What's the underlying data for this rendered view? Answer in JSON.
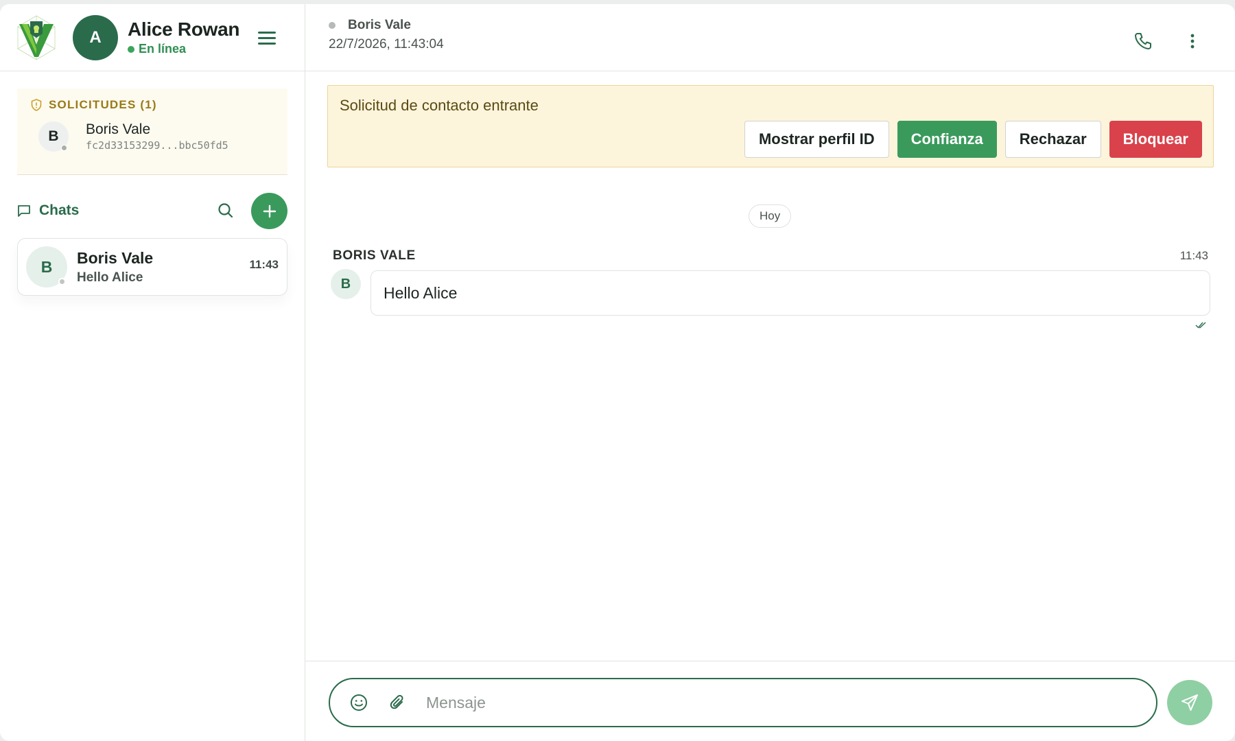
{
  "colors": {
    "brand": "#2a6b4b",
    "accent_green": "#3a9a5c",
    "danger": "#d9424b",
    "warning_bg": "#fdf4dc",
    "online": "#3aa55d"
  },
  "user": {
    "avatar_letter": "A",
    "name": "Alice Rowan",
    "status": "En línea"
  },
  "requests": {
    "title": "SOLICITUDES (1)",
    "items": [
      {
        "avatar_letter": "B",
        "name": "Boris Vale",
        "id": "fc2d33153299...bbc50fd5"
      }
    ]
  },
  "chats": {
    "title": "Chats",
    "items": [
      {
        "avatar_letter": "B",
        "name": "Boris Vale",
        "preview": "Hello Alice",
        "time": "11:43"
      }
    ]
  },
  "conversation": {
    "peer_name": "Boris Vale",
    "timestamp": "22/7/2026, 11:43:04",
    "banner": {
      "text": "Solicitud de contacto entrante",
      "show_profile": "Mostrar perfil ID",
      "trust": "Confianza",
      "reject": "Rechazar",
      "block": "Bloquear"
    },
    "day_label": "Hoy",
    "messages": [
      {
        "sender": "BORIS VALE",
        "avatar_letter": "B",
        "text": "Hello Alice",
        "time": "11:43"
      }
    ]
  },
  "composer": {
    "placeholder": "Mensaje",
    "value": ""
  },
  "icons": [
    "app-logo",
    "menu-icon",
    "shield-icon",
    "chat-bubble-icon",
    "search-icon",
    "plus-icon",
    "phone-icon",
    "more-vertical-icon",
    "double-check-icon",
    "emoji-icon",
    "paperclip-icon",
    "send-icon"
  ]
}
